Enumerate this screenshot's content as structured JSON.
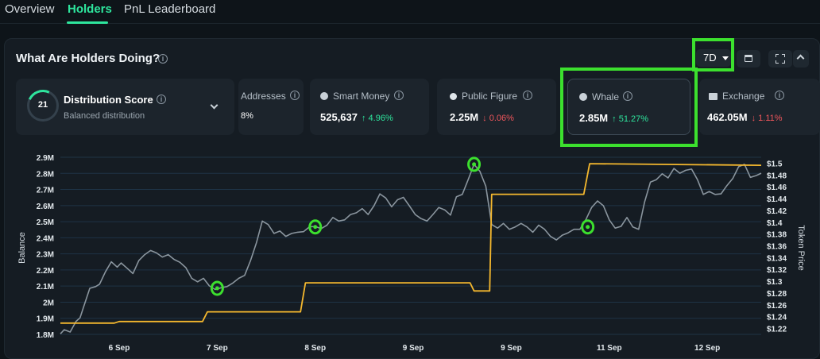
{
  "tabs": [
    {
      "label": "Overview"
    },
    {
      "label": "Holders"
    },
    {
      "label": "PnL Leaderboard"
    }
  ],
  "card": {
    "title": "What Are Holders Doing?",
    "range": "7D"
  },
  "metrics": {
    "distribution": {
      "score": "21",
      "title": "Distribution Score",
      "subtitle": "Balanced distribution"
    },
    "addresses": {
      "label": "Addresses",
      "value": "8%"
    },
    "smart_money": {
      "label": "Smart Money",
      "value": "525,637",
      "change": "↑ 4.96%"
    },
    "public_figure": {
      "label": "Public Figure",
      "value": "2.25M",
      "change": "↓ 0.06%"
    },
    "whale": {
      "label": "Whale",
      "value": "2.85M",
      "change": "↑ 51.27%"
    },
    "exchange": {
      "label": "Exchange",
      "value": "462.05M",
      "change": "↓ 1.11%"
    }
  },
  "colors": {
    "accent": "#2ee59d",
    "up": "#2ee59d",
    "down": "#f0565c",
    "balance_line": "#f5b82e",
    "price_line": "#8a959e",
    "highlight": "#3ce02e"
  },
  "chart_data": {
    "type": "line",
    "xlabel": "",
    "ylabel": "Balance",
    "y2label": "Token Price",
    "x_ticks": [
      "6 Sep",
      "7 Sep",
      "8 Sep",
      "9 Sep",
      "9 Sep",
      "11 Sep",
      "12 Sep"
    ],
    "y_ticks": [
      "1.8M",
      "1.9M",
      "2M",
      "2.1M",
      "2.2M",
      "2.3M",
      "2.4M",
      "2.5M",
      "2.6M",
      "2.7M",
      "2.8M",
      "2.9M"
    ],
    "y2_ticks": [
      "$1.22",
      "$1.24",
      "$1.26",
      "$1.28",
      "$1.3",
      "$1.32",
      "$1.34",
      "$1.36",
      "$1.38",
      "$1.4",
      "$1.42",
      "$1.44",
      "$1.46",
      "$1.48",
      "$1.5"
    ],
    "ylim": [
      1.8,
      2.9
    ],
    "y2lim": [
      1.21,
      1.51
    ],
    "x_tick_positions": [
      1,
      2,
      3,
      4,
      5,
      6,
      7
    ],
    "xlim": [
      0.4,
      7.55
    ],
    "grid": true,
    "balance": {
      "x": [
        0.4,
        0.95,
        1.0,
        1.85,
        1.9,
        2.85,
        2.9,
        4.58,
        4.62,
        4.78,
        4.8,
        5.74,
        5.8,
        7.55
      ],
      "y": [
        1.87,
        1.87,
        1.88,
        1.88,
        1.94,
        1.94,
        2.12,
        2.12,
        2.07,
        2.07,
        2.67,
        2.67,
        2.86,
        2.85
      ]
    },
    "price": {
      "x": [
        0.4,
        0.44,
        0.5,
        0.56,
        0.6,
        0.64,
        0.7,
        0.76,
        0.8,
        0.86,
        0.92,
        0.98,
        1.02,
        1.08,
        1.14,
        1.2,
        1.26,
        1.32,
        1.38,
        1.44,
        1.5,
        1.56,
        1.62,
        1.68,
        1.74,
        1.8,
        1.86,
        1.92,
        1.98,
        2.04,
        2.1,
        2.16,
        2.22,
        2.28,
        2.34,
        2.4,
        2.46,
        2.52,
        2.58,
        2.64,
        2.7,
        2.76,
        2.82,
        2.88,
        2.94,
        3.0,
        3.06,
        3.12,
        3.18,
        3.24,
        3.3,
        3.36,
        3.42,
        3.48,
        3.54,
        3.6,
        3.66,
        3.72,
        3.78,
        3.84,
        3.9,
        3.96,
        4.02,
        4.08,
        4.14,
        4.2,
        4.26,
        4.32,
        4.38,
        4.44,
        4.5,
        4.56,
        4.62,
        4.68,
        4.74,
        4.8,
        4.86,
        4.92,
        4.98,
        5.04,
        5.1,
        5.16,
        5.22,
        5.28,
        5.34,
        5.4,
        5.46,
        5.52,
        5.58,
        5.64,
        5.7,
        5.76,
        5.82,
        5.88,
        5.94,
        6.0,
        6.06,
        6.12,
        6.18,
        6.24,
        6.3,
        6.36,
        6.42,
        6.48,
        6.54,
        6.6,
        6.66,
        6.72,
        6.78,
        6.84,
        6.9,
        6.96,
        7.02,
        7.08,
        7.14,
        7.2,
        7.26,
        7.32,
        7.38,
        7.44,
        7.5,
        7.55
      ],
      "y": [
        1.211,
        1.218,
        1.214,
        1.232,
        1.238,
        1.258,
        1.288,
        1.291,
        1.295,
        1.316,
        1.333,
        1.324,
        1.331,
        1.322,
        1.313,
        1.335,
        1.345,
        1.352,
        1.348,
        1.341,
        1.345,
        1.337,
        1.332,
        1.323,
        1.305,
        1.299,
        1.305,
        1.292,
        1.286,
        1.289,
        1.291,
        1.297,
        1.305,
        1.31,
        1.335,
        1.365,
        1.402,
        1.396,
        1.381,
        1.385,
        1.376,
        1.381,
        1.383,
        1.384,
        1.392,
        1.393,
        1.389,
        1.395,
        1.408,
        1.402,
        1.404,
        1.413,
        1.416,
        1.423,
        1.413,
        1.428,
        1.448,
        1.441,
        1.426,
        1.438,
        1.442,
        1.428,
        1.413,
        1.406,
        1.402,
        1.413,
        1.425,
        1.421,
        1.412,
        1.443,
        1.447,
        1.472,
        1.498,
        1.486,
        1.461,
        1.396,
        1.39,
        1.398,
        1.388,
        1.392,
        1.398,
        1.392,
        1.383,
        1.395,
        1.388,
        1.376,
        1.37,
        1.378,
        1.382,
        1.388,
        1.388,
        1.404,
        1.425,
        1.436,
        1.428,
        1.404,
        1.39,
        1.393,
        1.408,
        1.392,
        1.388,
        1.434,
        1.468,
        1.472,
        1.482,
        1.475,
        1.491,
        1.483,
        1.488,
        1.49,
        1.472,
        1.447,
        1.452,
        1.447,
        1.448,
        1.462,
        1.474,
        1.494,
        1.498,
        1.476,
        1.479,
        1.483
      ]
    },
    "highlighted_points": [
      {
        "x": 2.0,
        "y": 1.288
      },
      {
        "x": 3.0,
        "y": 1.392
      },
      {
        "x": 4.62,
        "y": 1.498
      },
      {
        "x": 5.78,
        "y": 1.392
      }
    ]
  }
}
